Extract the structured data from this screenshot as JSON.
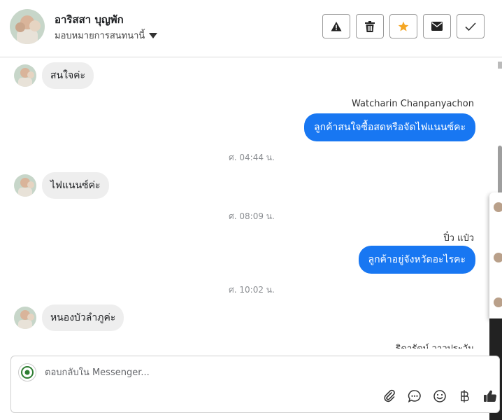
{
  "header": {
    "contact_name": "อาริสสา บุญพัก",
    "assign_label": "มอบหมายการสนทนานี้",
    "buttons": [
      {
        "name": "report-button",
        "icon": "warning-icon"
      },
      {
        "name": "delete-button",
        "icon": "trash-icon"
      },
      {
        "name": "star-button",
        "icon": "star-icon",
        "color": "#f5a623"
      },
      {
        "name": "mark-unread-button",
        "icon": "envelope-icon"
      },
      {
        "name": "mark-done-button",
        "icon": "check-icon"
      }
    ]
  },
  "thread": {
    "messages": [
      {
        "type": "in",
        "text": "สนใจค่ะ"
      },
      {
        "type": "sender",
        "text": "Watcharin Chanpanyachon"
      },
      {
        "type": "out",
        "text": "ลูกค้าสนใจซื้อสดหรือจัดไฟแนนซ์คะ"
      },
      {
        "type": "time",
        "text": "ศ. 04:44 น."
      },
      {
        "type": "in",
        "text": "ไฟแนนซ์ค่ะ"
      },
      {
        "type": "time",
        "text": "ศ. 08:09 น."
      },
      {
        "type": "sender",
        "text": "ปิ๋ว แป๋ว"
      },
      {
        "type": "out",
        "text": "ลูกค้าอยู่จังหวัดอะไรคะ"
      },
      {
        "type": "time",
        "text": "ศ. 10:02 น."
      },
      {
        "type": "in",
        "text": "หนองบัวลำภูค่ะ"
      },
      {
        "type": "sender",
        "text": "ธิดารัตน์ วาวประวัน"
      }
    ]
  },
  "composer": {
    "placeholder": "ตอบกลับใน Messenger...",
    "tools": [
      "paperclip-icon",
      "saved-reply-icon",
      "emoji-icon",
      "baht-icon",
      "thumbs-up-icon"
    ]
  },
  "colors": {
    "accent": "#1877f2",
    "incoming_bubble": "#eeeeee",
    "star": "#f5a623"
  }
}
